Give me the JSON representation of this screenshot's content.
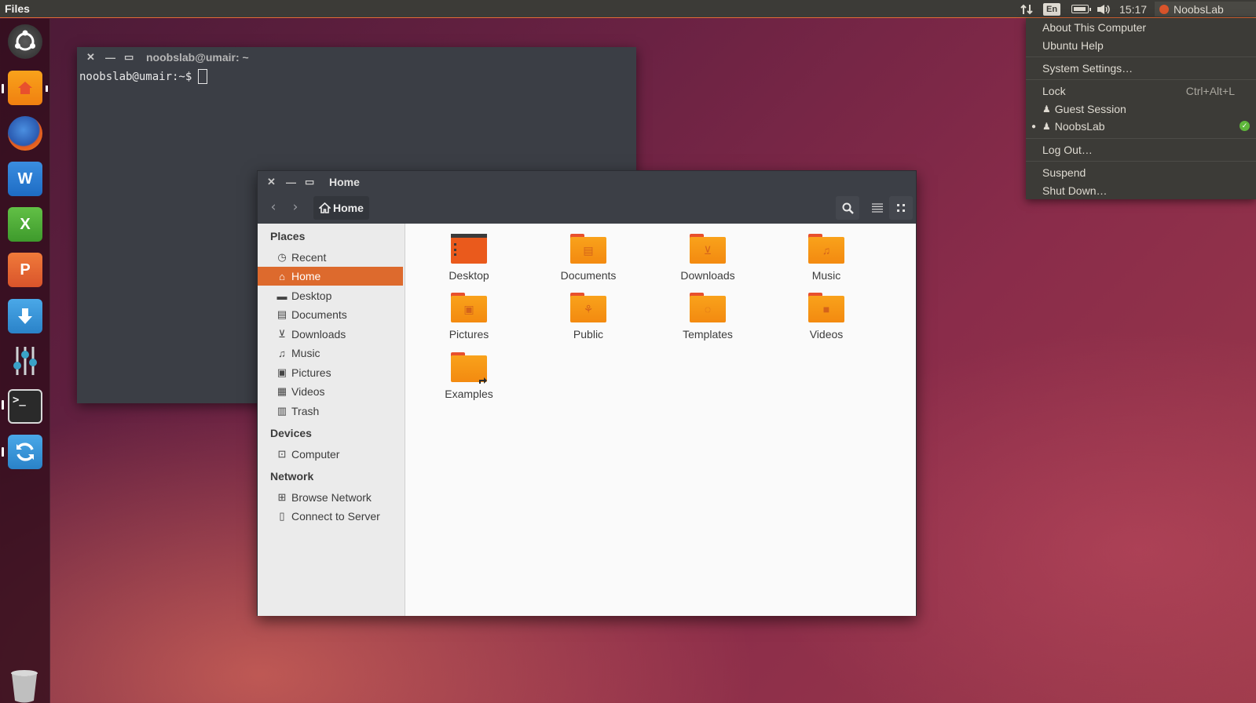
{
  "top_panel": {
    "app_title": "Files",
    "lang": "En",
    "time": "15:17",
    "user": "NoobsLab"
  },
  "terminal": {
    "title": "noobslab@umair: ~",
    "prompt": "noobslab@umair:~$"
  },
  "files_window": {
    "title": "Home",
    "breadcrumb": "Home",
    "sidebar": {
      "places_header": "Places",
      "places": [
        {
          "label": "Recent",
          "icon": "clock-icon"
        },
        {
          "label": "Home",
          "icon": "home-icon"
        },
        {
          "label": "Desktop",
          "icon": "desktop-icon"
        },
        {
          "label": "Documents",
          "icon": "document-icon"
        },
        {
          "label": "Downloads",
          "icon": "download-icon"
        },
        {
          "label": "Music",
          "icon": "music-icon"
        },
        {
          "label": "Pictures",
          "icon": "picture-icon"
        },
        {
          "label": "Videos",
          "icon": "video-icon"
        },
        {
          "label": "Trash",
          "icon": "trash-icon"
        }
      ],
      "devices_header": "Devices",
      "devices": [
        {
          "label": "Computer",
          "icon": "drive-icon"
        }
      ],
      "network_header": "Network",
      "network": [
        {
          "label": "Browse Network",
          "icon": "network-icon"
        },
        {
          "label": "Connect to Server",
          "icon": "server-icon"
        }
      ]
    },
    "items": [
      {
        "label": "Desktop"
      },
      {
        "label": "Documents"
      },
      {
        "label": "Downloads"
      },
      {
        "label": "Music"
      },
      {
        "label": "Pictures"
      },
      {
        "label": "Public"
      },
      {
        "label": "Templates"
      },
      {
        "label": "Videos"
      },
      {
        "label": "Examples"
      }
    ]
  },
  "user_menu": {
    "about": "About This Computer",
    "help": "Ubuntu Help",
    "settings": "System Settings…",
    "lock": "Lock",
    "lock_shortcut": "Ctrl+Alt+L",
    "guest": "Guest Session",
    "current_user": "NoobsLab",
    "logout": "Log Out…",
    "suspend": "Suspend",
    "shutdown": "Shut Down…"
  },
  "colors": {
    "accent": "#dd6a2d",
    "folder": "#f7941d",
    "panel": "#3c3b37"
  }
}
